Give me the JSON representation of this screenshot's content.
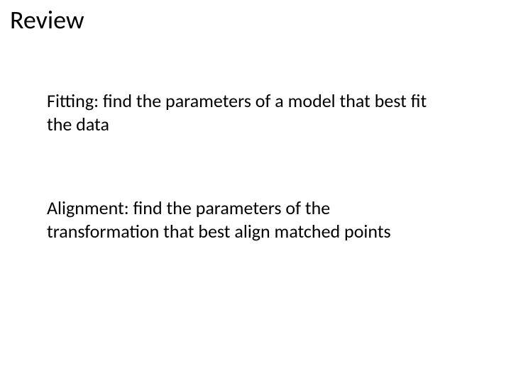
{
  "title": "Review",
  "paragraphs": [
    "Fitting: find the parameters of a model that best fit the data",
    "Alignment: find the parameters of the transformation that best align matched points"
  ]
}
